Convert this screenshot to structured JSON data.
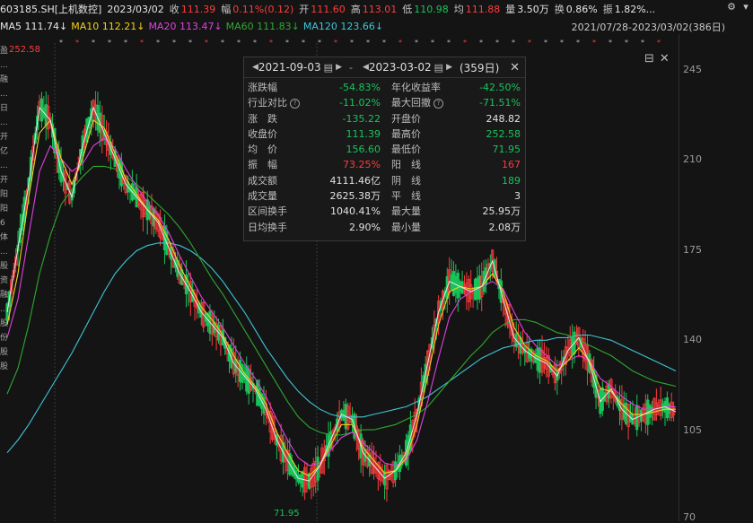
{
  "quote": {
    "symbol": "603185.SH[上机数控]",
    "date": "2023/03/02",
    "close_label": "收",
    "close": "111.39",
    "change_label": "幅",
    "change": "0.11%(0.12)",
    "open_label": "开",
    "open": "111.60",
    "high_label": "高",
    "high": "113.01",
    "low_label": "低",
    "low": "110.98",
    "avg_label": "均",
    "avg": "111.88",
    "vol_label": "量",
    "vol": "3.50万",
    "turn_label": "换",
    "turn": "0.86%",
    "amp_label": "振",
    "amp": "1.82%..."
  },
  "ma": {
    "ma5": "MA5 111.74↓",
    "ma10": "MA10 112.21↓",
    "ma20": "MA20 113.47↓",
    "ma60": "MA60 111.83↓",
    "ma120": "MA120 123.66↓"
  },
  "range_text": "2021/07/28-2023/03/02(386日)",
  "left_strip": [
    "盈",
    "...",
    "融",
    "...",
    "日",
    "...",
    "开",
    "亿",
    "...",
    "开",
    "阳",
    "阳",
    "6",
    "体",
    "...",
    "股",
    "资",
    "融",
    "...",
    "股",
    "份",
    "股",
    "股"
  ],
  "markers": {
    "high": "252.58",
    "low": "71.95"
  },
  "yaxis": [
    "245",
    "210",
    "175",
    "140",
    "105",
    "70"
  ],
  "popup": {
    "start_date": "2021-09-03",
    "end_date": "2023-03-02",
    "days": "(359日)",
    "dash": "-",
    "rows": [
      {
        "l1": "涨跌幅",
        "v1": "-54.83%",
        "c1": "g",
        "l2": "年化收益率",
        "v2": "-42.50%",
        "c2": "g"
      },
      {
        "l1": "行业对比",
        "q1": true,
        "v1": "-11.02%",
        "c1": "g",
        "l2": "最大回撤",
        "q2": true,
        "v2": "-71.51%",
        "c2": "g"
      },
      {
        "l1": "涨　跌",
        "v1": "-135.22",
        "c1": "g",
        "l2": "开盘价",
        "v2": "248.82",
        "c2": ""
      },
      {
        "l1": "收盘价",
        "v1": "111.39",
        "c1": "g",
        "l2": "最高价",
        "v2": "252.58",
        "c2": "g"
      },
      {
        "l1": "均　价",
        "v1": "156.60",
        "c1": "g",
        "l2": "最低价",
        "v2": "71.95",
        "c2": "g"
      },
      {
        "l1": "振　幅",
        "v1": "73.25%",
        "c1": "r",
        "l2": "阳　线",
        "v2": "167",
        "c2": "r"
      },
      {
        "l1": "成交额",
        "v1": "4111.46亿",
        "c1": "",
        "l2": "阴　线",
        "v2": "189",
        "c2": "g"
      },
      {
        "l1": "成交量",
        "v1": "2625.38万",
        "c1": "",
        "l2": "平　线",
        "v2": "3",
        "c2": ""
      },
      {
        "l1": "区间换手",
        "v1": "1040.41%",
        "c1": "",
        "l2": "最大量",
        "v2": "25.95万",
        "c2": ""
      },
      {
        "l1": "日均换手",
        "v1": "2.90%",
        "c1": "",
        "l2": "最小量",
        "v2": "2.08万",
        "c2": ""
      }
    ]
  },
  "colors": {
    "up": "#ff3b3b",
    "down": "#19c35a",
    "ma5": "#e8e8e8",
    "ma10": "#f2d21b",
    "ma20": "#e040e0",
    "ma60": "#2fa82f",
    "ma120": "#3ec6d6"
  },
  "series": {
    "ma5": [
      150,
      175,
      200,
      230,
      225,
      205,
      195,
      215,
      230,
      220,
      210,
      200,
      195,
      190,
      185,
      175,
      165,
      158,
      150,
      145,
      140,
      130,
      125,
      120,
      112,
      100,
      92,
      85,
      84,
      90,
      100,
      110,
      108,
      95,
      90,
      85,
      88,
      95,
      110,
      130,
      150,
      162,
      160,
      158,
      160,
      170,
      155,
      140,
      135,
      132,
      130,
      125,
      135,
      140,
      130,
      115,
      120,
      112,
      108,
      110,
      112,
      113,
      111
    ],
    "ma10": [
      145,
      165,
      195,
      220,
      225,
      210,
      200,
      210,
      225,
      222,
      212,
      202,
      196,
      190,
      186,
      178,
      168,
      160,
      152,
      147,
      141,
      133,
      126,
      121,
      114,
      103,
      95,
      88,
      86,
      90,
      98,
      106,
      106,
      97,
      92,
      87,
      88,
      93,
      106,
      125,
      145,
      158,
      160,
      159,
      160,
      165,
      158,
      144,
      137,
      133,
      131,
      127,
      131,
      136,
      131,
      120,
      119,
      114,
      110,
      110,
      111,
      112,
      112
    ],
    "ma20": [
      140,
      155,
      180,
      205,
      215,
      210,
      205,
      208,
      215,
      218,
      214,
      206,
      199,
      193,
      188,
      181,
      172,
      164,
      156,
      150,
      144,
      137,
      130,
      124,
      117,
      108,
      100,
      93,
      90,
      91,
      96,
      101,
      103,
      99,
      95,
      91,
      90,
      92,
      100,
      115,
      132,
      148,
      155,
      158,
      160,
      162,
      159,
      150,
      142,
      137,
      133,
      129,
      131,
      133,
      131,
      124,
      121,
      117,
      114,
      112,
      112,
      113,
      113
    ],
    "ma60": [
      118,
      128,
      145,
      165,
      180,
      192,
      198,
      203,
      207,
      207,
      206,
      203,
      200,
      196,
      192,
      188,
      183,
      177,
      170,
      163,
      157,
      150,
      143,
      136,
      129,
      122,
      115,
      109,
      105,
      103,
      102,
      102,
      103,
      104,
      104,
      105,
      106,
      108,
      110,
      113,
      118,
      123,
      128,
      133,
      137,
      142,
      145,
      147,
      147,
      146,
      144,
      142,
      141,
      139,
      137,
      135,
      133,
      130,
      127,
      125,
      123,
      122,
      121
    ],
    "ma120": [
      95,
      100,
      106,
      113,
      120,
      127,
      134,
      142,
      150,
      158,
      165,
      170,
      174,
      176,
      177,
      177,
      176,
      174,
      171,
      167,
      162,
      156,
      150,
      143,
      136,
      130,
      124,
      119,
      115,
      112,
      110,
      109,
      109,
      109,
      110,
      111,
      112,
      113,
      115,
      117,
      120,
      123,
      126,
      129,
      132,
      134,
      136,
      137,
      138,
      139,
      139,
      140,
      140,
      141,
      141,
      140,
      139,
      137,
      135,
      133,
      131,
      129,
      127
    ]
  }
}
